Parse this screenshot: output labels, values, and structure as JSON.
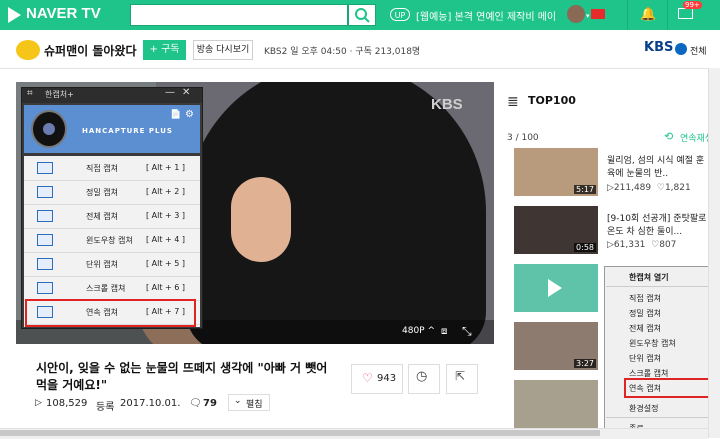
{
  "topbar": {
    "logo": "NAVER TV",
    "search_value": "",
    "up_badge": "UP",
    "ticker": "[웹예능] 본격 연예인 제작비 메이...",
    "mail_badge": "99+",
    "icons": [
      "play-logo-icon",
      "search-icon",
      "bell-icon",
      "mail-icon"
    ],
    "accent_color": "#1ec489"
  },
  "channel": {
    "title": "슈퍼맨이 돌아왔다",
    "subscribe": "+ 구독",
    "replay": "방송 다시보기",
    "broadcast_info": "KBS2   일 오후 04:50  ·  구독 213,018명",
    "network_logo": "KBS",
    "all_label": "전체"
  },
  "video": {
    "watermark": "KBS",
    "quality": "480P ^"
  },
  "capture": {
    "title": "한캡처+",
    "brand": "HANCAPTURE PLUS",
    "items": [
      {
        "label": "직접 캡쳐",
        "shortcut": "[ Alt + 1 ]"
      },
      {
        "label": "정밀 캡쳐",
        "shortcut": "[ Alt + 2 ]"
      },
      {
        "label": "전체 캡쳐",
        "shortcut": "[ Alt + 3 ]"
      },
      {
        "label": "윈도우창 캡쳐",
        "shortcut": "[ Alt + 4 ]"
      },
      {
        "label": "단위 캡쳐",
        "shortcut": "[ Alt + 5 ]"
      },
      {
        "label": "스크롤 캡쳐",
        "shortcut": "[ Alt + 6 ]"
      },
      {
        "label": "연속 캡쳐",
        "shortcut": "[ Alt + 7 ]"
      }
    ],
    "highlight_color": "#e02424"
  },
  "main": {
    "title_line1": "시안이, 잊을 수 없는 눈물의 뜨떼지 생각에 \"아빠 거 뺏어",
    "title_line2": "먹을 거예요!\"",
    "likes": "943",
    "views": "108,529",
    "date_label": "등록",
    "date": "2017.10.01.",
    "comments": "79",
    "fold": "펼침"
  },
  "sidebar": {
    "title": "TOP100",
    "rank": "3 / 100",
    "autoplay": "연속재생",
    "items": [
      {
        "title": "윌리엄, 섬의 시식 예절 훈육에 눈물의 반..",
        "views": "211,489",
        "likes": "1,821",
        "duration": "5:17"
      },
      {
        "title": "[9-10회 선공개] 준탓팔로 온도 차 심한 둘이...",
        "views": "61,331",
        "likes": "807",
        "duration": "0:58"
      },
      {
        "title": "",
        "views": "",
        "likes": "",
        "duration": ""
      },
      {
        "title": "",
        "views": "",
        "likes": "",
        "duration": "3:27"
      },
      {
        "title": "",
        "views": "",
        "likes": "",
        "duration": ""
      }
    ]
  },
  "context_menu": {
    "items": [
      "한캡쳐 열기",
      "직접 캡쳐",
      "정밀 캡쳐",
      "전체 캡쳐",
      "윈도우창 캡쳐",
      "단위 캡쳐",
      "스크롤 캡쳐",
      "연속 캡쳐",
      "환경설정",
      "종료"
    ]
  }
}
